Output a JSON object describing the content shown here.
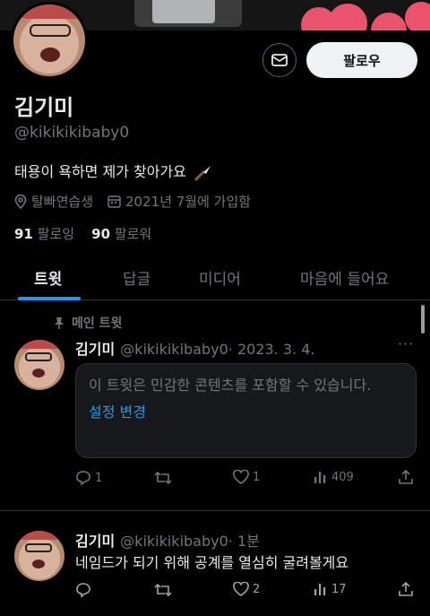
{
  "profile": {
    "name": "김기미",
    "handle": "@kikikikibaby0",
    "bio": "태용이 욕하면 제가 찾아가요",
    "location": "탈빠연습생",
    "joined": "2021년 7월에 가입함",
    "following_count": "91",
    "following_label": "팔로잉",
    "followers_count": "90",
    "followers_label": "팔로워",
    "follow_button": "팔로우"
  },
  "tabs": [
    "트윗",
    "답글",
    "미디어",
    "마음에 들어요"
  ],
  "pinned_label": "메인 트윗",
  "tweets": [
    {
      "name": "김기미",
      "handle": "@kikikikibaby0",
      "time": "· 2023. 3. 4.",
      "sensitive_msg": "이 트윗은 민감한 콘텐츠를 포함할 수 있습니다.",
      "sensitive_link": "설정 변경",
      "replies": "1",
      "retweets": "",
      "likes": "1",
      "views": "409"
    },
    {
      "name": "김기미",
      "handle": "@kikikikibaby0",
      "time": "· 1분",
      "text": "네임드가 되기 위해 공계를 열심히 굴려볼게요",
      "replies": "",
      "retweets": "",
      "likes": "2",
      "views": "17"
    }
  ],
  "colors": {
    "accent": "#1d9bf0",
    "background": "#000000",
    "muted": "#71767b",
    "text": "#e7e9ea"
  },
  "icons": [
    "mail-icon",
    "location-icon",
    "calendar-icon",
    "pin-icon",
    "knife-icon",
    "reply-icon",
    "retweet-icon",
    "like-icon",
    "views-icon",
    "share-icon",
    "more-icon"
  ]
}
